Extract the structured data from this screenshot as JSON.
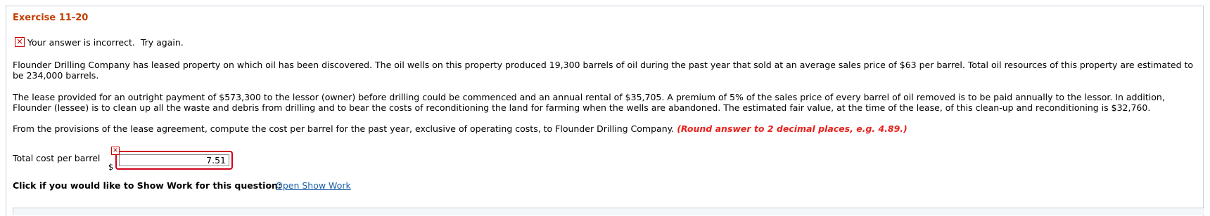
{
  "exercise": {
    "title": "Exercise 11-20"
  },
  "feedback": {
    "icon": "x-icon",
    "message": "Your answer is incorrect.  Try again."
  },
  "problem": {
    "paragraph1": "Flounder Drilling Company has leased property on which oil has been discovered. The oil wells on this property produced 19,300 barrels of oil during the past year that sold at an average sales price of $63 per barrel. Total oil resources of this property are estimated to be 234,000 barrels.",
    "paragraph2": "The lease provided for an outright payment of $573,300 to the lessor (owner) before drilling could be commenced and an annual rental of $35,705. A premium of 5% of the sales price of every barrel of oil removed is to be paid annually to the lessor. In addition, Flounder (lessee) is to clean up all the waste and debris from drilling and to bear the costs of reconditioning the land for farming when the wells are abandoned. The estimated fair value, at the time of the lease, of this clean-up and reconditioning is $32,760.",
    "paragraph3": "From the provisions of the lease agreement, compute the cost per barrel for the past year, exclusive of operating costs, to Flounder Drilling Company.",
    "hint": "(Round answer to 2 decimal places, e.g. 4.89.)"
  },
  "answer": {
    "label": "Total cost per barrel",
    "currency": "$",
    "value": "7.51",
    "status_icon": "x-icon"
  },
  "show_work": {
    "prompt": "Click if you would like to Show Work for this question:",
    "link": "Open Show Work"
  },
  "colors": {
    "title": "#c43d00",
    "error": "#d0021b",
    "hint": "#e8201a",
    "link": "#1a5fa8"
  }
}
